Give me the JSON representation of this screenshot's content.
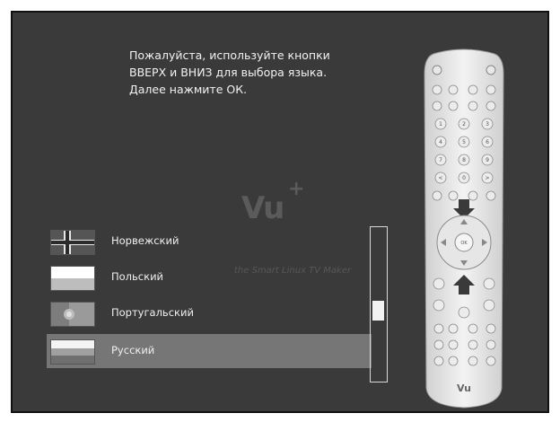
{
  "instruction_lines": [
    "Пожалуйста, используйте кнопки",
    "ВВЕРХ и ВНИЗ для выбора языка.",
    "Далее нажмите ОК."
  ],
  "logo": {
    "text": "Vu",
    "tagline": "the Smart Linux TV Maker"
  },
  "languages": [
    {
      "label": "Норвежский",
      "flag_colors": [
        "#e8e8e8",
        "#444444"
      ],
      "selected": false
    },
    {
      "label": "Польский",
      "flag_colors": [
        "#ffffff",
        "#bdbdbd"
      ],
      "selected": false
    },
    {
      "label": "Португальский",
      "flag_colors": [
        "#8a8a8a",
        "#9a9a9a"
      ],
      "selected": false
    },
    {
      "label": "Русский",
      "flag_colors": [
        "#ffffff",
        "#a0a0a0",
        "#6f6f6f"
      ],
      "selected": true
    }
  ],
  "scroll": {
    "position_fraction": 0.55
  },
  "remote": {
    "ok_label": "OK",
    "brand": "Vu",
    "digits": [
      "1",
      "2",
      "3",
      "4",
      "5",
      "6",
      "7",
      "8",
      "9",
      "<",
      "0",
      ">"
    ]
  },
  "colors": {
    "screen_bg": "#3a3a3a",
    "selected_bg": "#767676",
    "text": "#f0f0f0"
  }
}
